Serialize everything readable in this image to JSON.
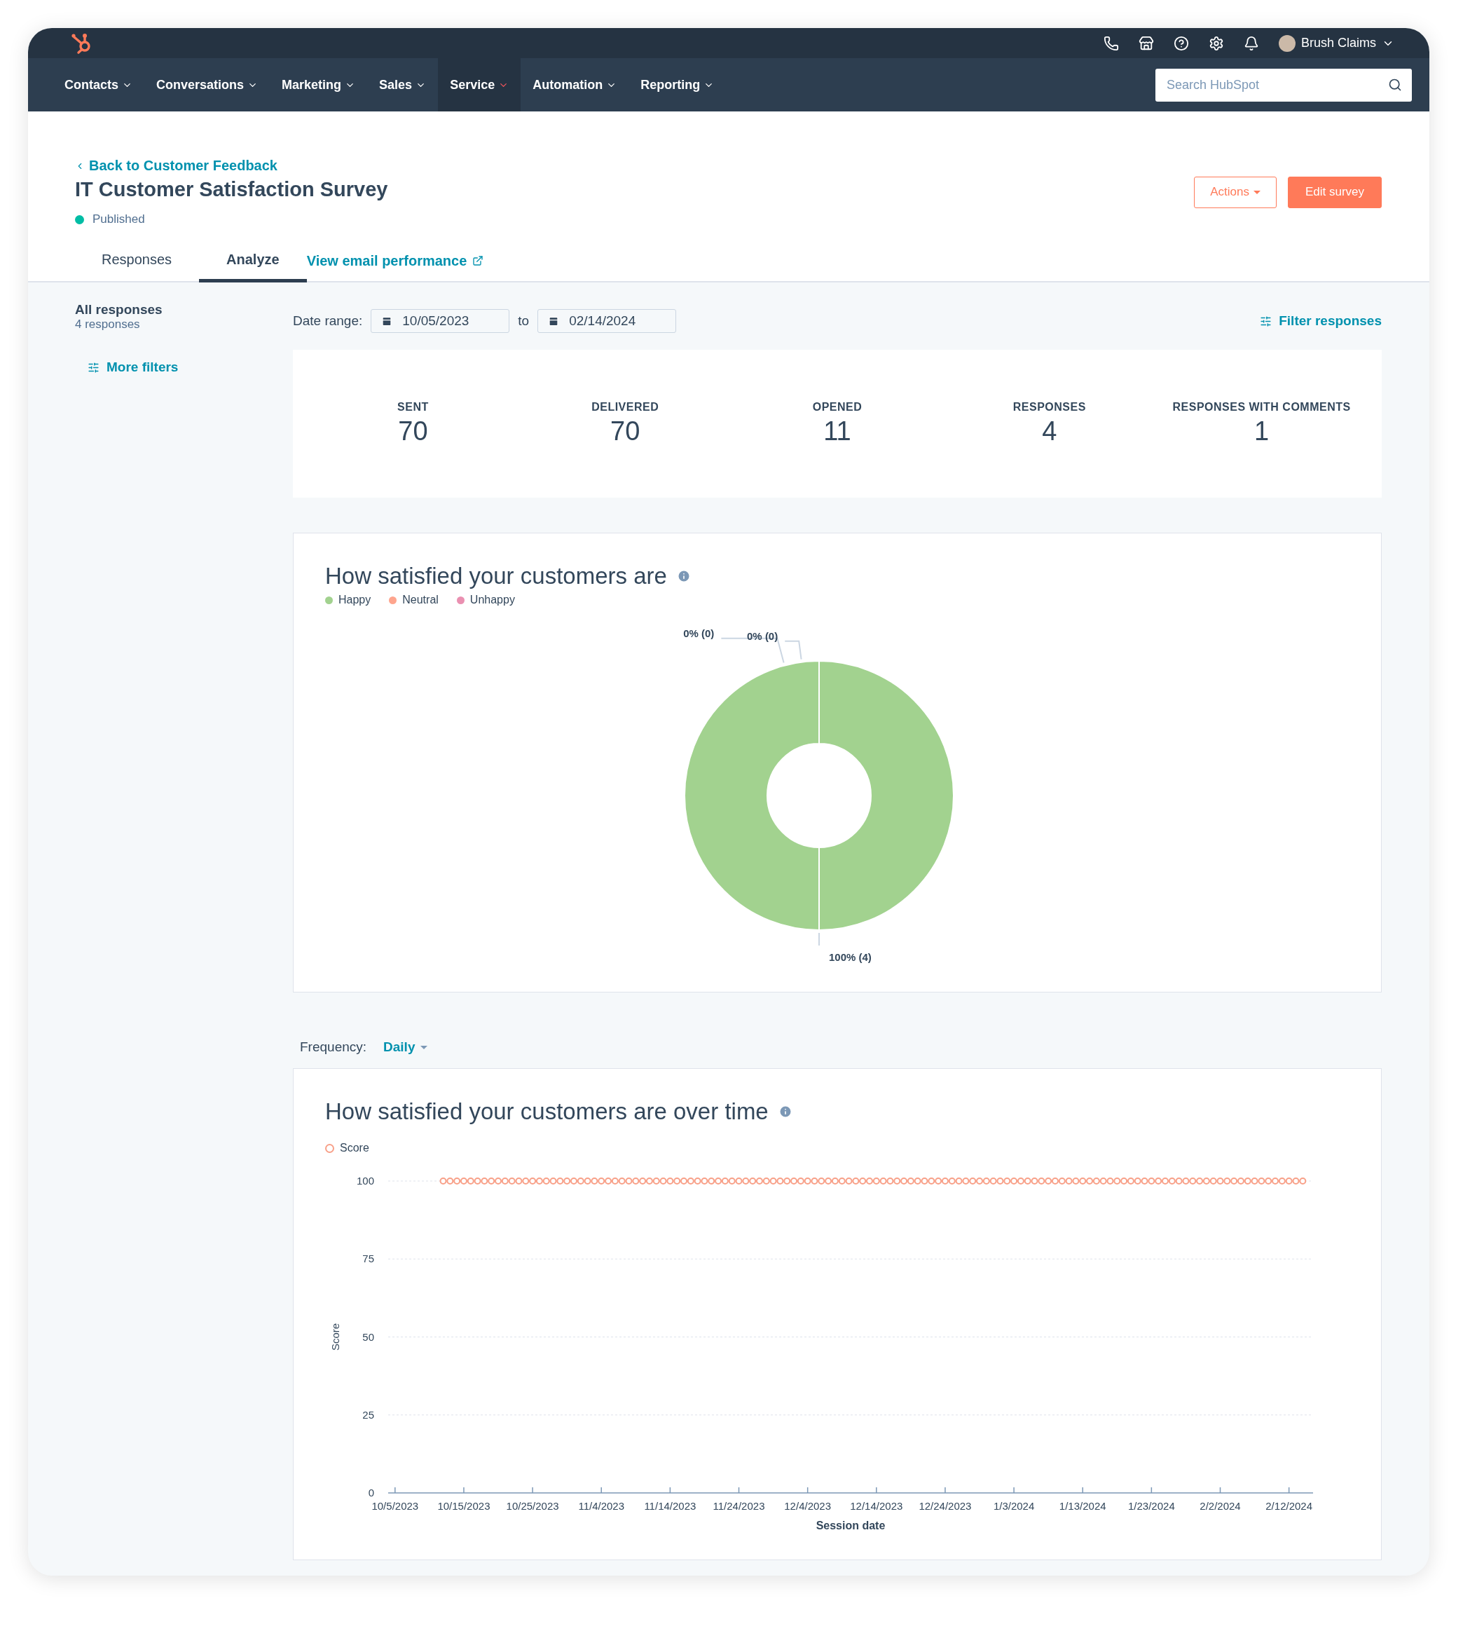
{
  "top_bar": {
    "account_name": "Brush Claims"
  },
  "nav": {
    "items": [
      {
        "label": "Contacts",
        "selected": false
      },
      {
        "label": "Conversations",
        "selected": false
      },
      {
        "label": "Marketing",
        "selected": false
      },
      {
        "label": "Sales",
        "selected": false
      },
      {
        "label": "Service",
        "selected": true
      },
      {
        "label": "Automation",
        "selected": false
      },
      {
        "label": "Reporting",
        "selected": false
      }
    ],
    "search": {
      "placeholder": "Search HubSpot"
    }
  },
  "header": {
    "back_link": "Back to Customer Feedback",
    "title": "IT Customer Satisfaction Survey",
    "status": "Published",
    "actions_button": "Actions",
    "edit_button": "Edit survey"
  },
  "tabs": [
    {
      "label": "Responses",
      "selected": false,
      "kind": "tab"
    },
    {
      "label": "Analyze",
      "selected": true,
      "kind": "tab"
    },
    {
      "label": "View email performance",
      "selected": false,
      "kind": "external-link"
    }
  ],
  "sidebar": {
    "title": "All responses",
    "count": "4 responses",
    "more_filters": "More filters"
  },
  "date_range": {
    "label": "Date range:",
    "from": "10/05/2023",
    "separator": "to",
    "to": "02/14/2024",
    "filter_link": "Filter responses"
  },
  "stats": [
    {
      "label": "SENT",
      "value": "70"
    },
    {
      "label": "DELIVERED",
      "value": "70"
    },
    {
      "label": "OPENED",
      "value": "11"
    },
    {
      "label": "RESPONSES",
      "value": "4"
    },
    {
      "label": "RESPONSES WITH COMMENTS",
      "value": "1"
    }
  ],
  "satisfaction_card": {
    "title": "How satisfied your customers are",
    "chart_data": {
      "type": "pie",
      "categories": [
        "Happy",
        "Neutral",
        "Unhappy"
      ],
      "colors": [
        "#a2d28f",
        "#fea58e",
        "#ea90b1"
      ],
      "values": [
        100,
        0,
        0
      ],
      "value_labels": [
        "100% (4)",
        "0% (0)",
        "0% (0)"
      ]
    }
  },
  "frequency": {
    "label": "Frequency:",
    "value": "Daily"
  },
  "trend_card": {
    "title": "How satisfied your customers are over time",
    "chart_data": {
      "type": "line",
      "xlabel": "Session date",
      "ylabel": "Score",
      "grid": true,
      "ylim": [
        0,
        100
      ],
      "yticks": [
        0,
        25,
        50,
        75,
        100
      ],
      "categories": [
        "10/5/2023",
        null,
        null,
        null,
        null,
        null,
        null,
        null,
        null,
        null,
        "10/15/2023",
        null,
        null,
        null,
        null,
        null,
        null,
        null,
        null,
        null,
        "10/25/2023",
        null,
        null,
        null,
        null,
        null,
        null,
        null,
        null,
        null,
        "11/4/2023",
        null,
        null,
        null,
        null,
        null,
        null,
        null,
        null,
        null,
        "11/14/2023",
        null,
        null,
        null,
        null,
        null,
        null,
        null,
        null,
        null,
        "11/24/2023",
        null,
        null,
        null,
        null,
        null,
        null,
        null,
        null,
        null,
        "12/4/2023",
        null,
        null,
        null,
        null,
        null,
        null,
        null,
        null,
        null,
        "12/14/2023",
        null,
        null,
        null,
        null,
        null,
        null,
        null,
        null,
        null,
        "12/24/2023",
        null,
        null,
        null,
        null,
        null,
        null,
        null,
        null,
        null,
        "1/3/2024",
        null,
        null,
        null,
        null,
        null,
        null,
        null,
        null,
        null,
        "1/13/2024",
        null,
        null,
        null,
        null,
        null,
        null,
        null,
        null,
        null,
        "1/23/2024",
        null,
        null,
        null,
        null,
        null,
        null,
        null,
        null,
        null,
        "2/2/2024",
        null,
        null,
        null,
        null,
        null,
        null,
        null,
        null,
        null,
        "2/12/2024",
        null,
        null
      ],
      "series": [
        {
          "name": "Score",
          "color": "#f8a088",
          "marker": "circle",
          "values": [
            null,
            null,
            null,
            null,
            null,
            null,
            null,
            100,
            100,
            100,
            100,
            100,
            100,
            100,
            100,
            100,
            100,
            100,
            100,
            100,
            100,
            100,
            100,
            100,
            100,
            100,
            100,
            100,
            100,
            100,
            100,
            100,
            100,
            100,
            100,
            100,
            100,
            100,
            100,
            100,
            100,
            100,
            100,
            100,
            100,
            100,
            100,
            100,
            100,
            100,
            100,
            100,
            100,
            100,
            100,
            100,
            100,
            100,
            100,
            100,
            100,
            100,
            100,
            100,
            100,
            100,
            100,
            100,
            100,
            100,
            100,
            100,
            100,
            100,
            100,
            100,
            100,
            100,
            100,
            100,
            100,
            100,
            100,
            100,
            100,
            100,
            100,
            100,
            100,
            100,
            100,
            100,
            100,
            100,
            100,
            100,
            100,
            100,
            100,
            100,
            100,
            100,
            100,
            100,
            100,
            100,
            100,
            100,
            100,
            100,
            100,
            100,
            100,
            100,
            100,
            100,
            100,
            100,
            100,
            100,
            100,
            100,
            100,
            100,
            100,
            100,
            100,
            100,
            100,
            100,
            100,
            100,
            100
          ]
        }
      ]
    }
  }
}
